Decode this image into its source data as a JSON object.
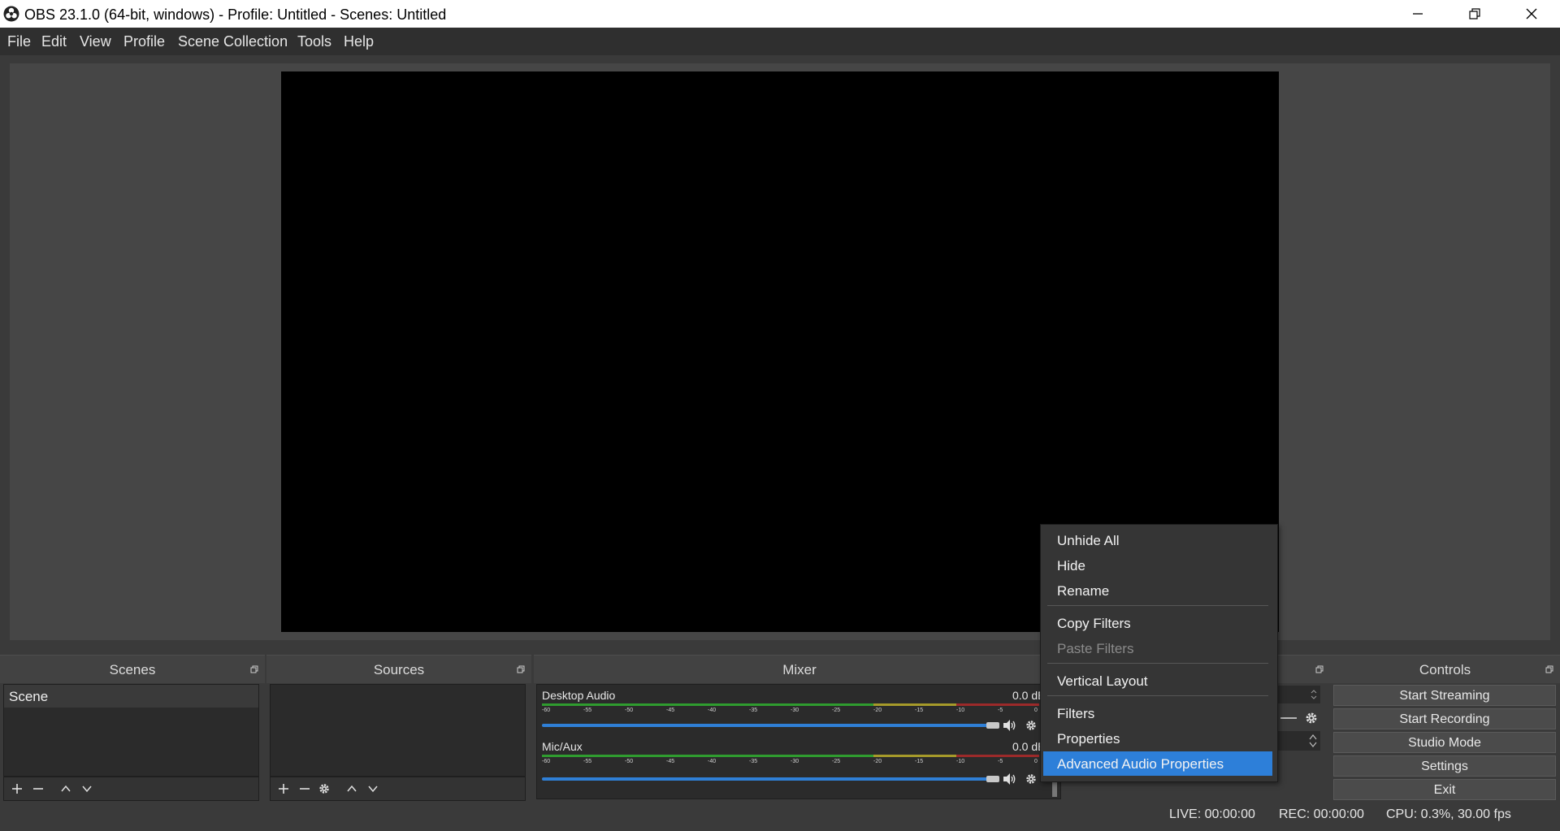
{
  "window": {
    "title": "OBS 23.1.0 (64-bit, windows) - Profile: Untitled - Scenes: Untitled"
  },
  "menu": [
    "File",
    "Edit",
    "View",
    "Profile",
    "Scene Collection",
    "Tools",
    "Help"
  ],
  "docks": {
    "scenes": {
      "title": "Scenes",
      "items": [
        "Scene"
      ]
    },
    "sources": {
      "title": "Sources"
    },
    "mixer": {
      "title": "Mixer",
      "channels": [
        {
          "name": "Desktop Audio",
          "db": "0.0 dB",
          "volume": 1.0
        },
        {
          "name": "Mic/Aux",
          "db": "0.0 dB",
          "volume": 1.0
        }
      ],
      "ticks": [
        "-60",
        "-55",
        "-50",
        "-45",
        "-40",
        "-35",
        "-30",
        "-25",
        "-20",
        "-15",
        "-10",
        "-5",
        "0"
      ]
    },
    "controls": {
      "title": "Controls",
      "buttons": [
        "Start Streaming",
        "Start Recording",
        "Studio Mode",
        "Settings",
        "Exit"
      ]
    }
  },
  "context_menu": {
    "items": [
      {
        "label": "Unhide All",
        "enabled": true
      },
      {
        "label": "Hide",
        "enabled": true
      },
      {
        "label": "Rename",
        "enabled": true
      },
      {
        "label": "Copy Filters",
        "enabled": true
      },
      {
        "label": "Paste Filters",
        "enabled": false
      },
      {
        "label": "Vertical Layout",
        "enabled": true
      },
      {
        "label": "Filters",
        "enabled": true
      },
      {
        "label": "Properties",
        "enabled": true
      },
      {
        "label": "Advanced Audio Properties",
        "enabled": true,
        "highlighted": true
      }
    ]
  },
  "status": {
    "live": "LIVE: 00:00:00",
    "rec": "REC: 00:00:00",
    "cpu": "CPU: 0.3%, 30.00 fps"
  },
  "colors": {
    "accent": "#2d7fd9",
    "meter_green": "#2f9c2f",
    "meter_yellow": "#a69a2a",
    "meter_red": "#9c2a2a"
  }
}
